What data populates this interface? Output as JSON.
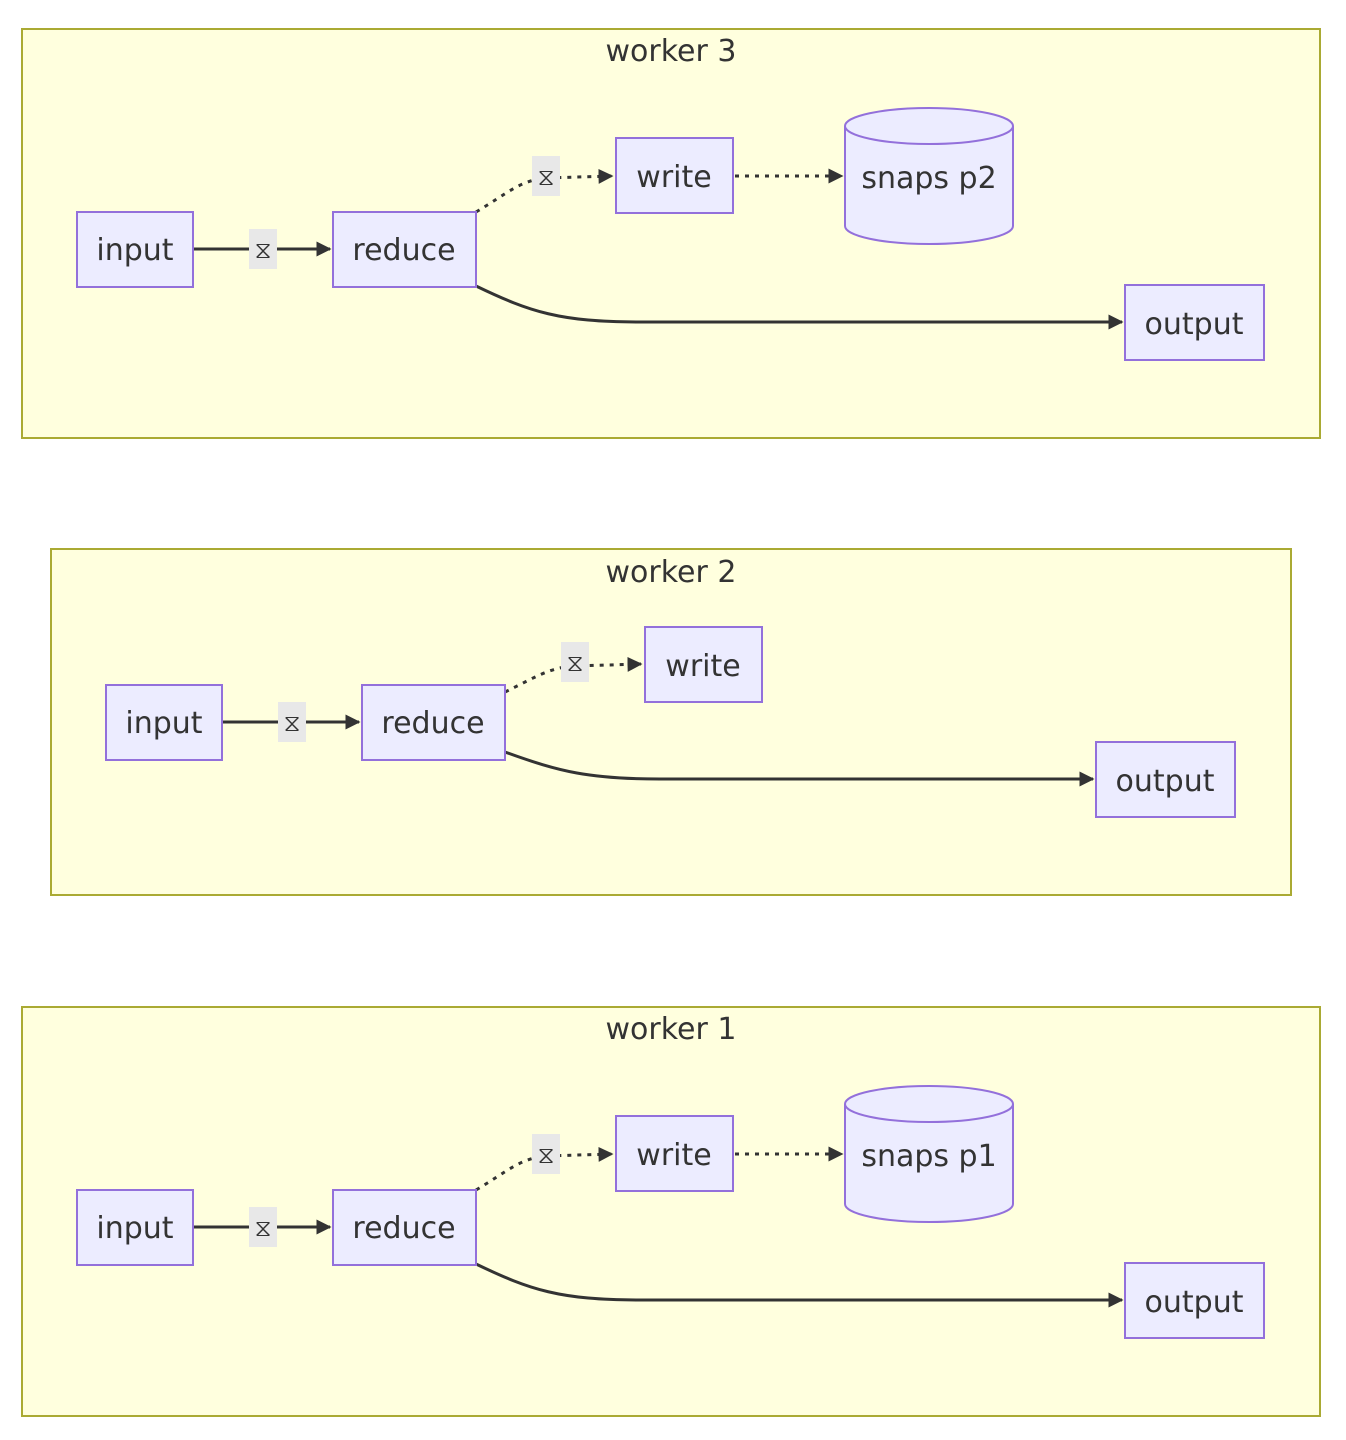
{
  "diagram": {
    "type": "flowchart",
    "edge_label_icon": "hourglass-icon",
    "edge_label_glyph": "⧖",
    "colors": {
      "cluster_fill": "#ffffde",
      "cluster_stroke": "#aaaa33",
      "node_fill": "#ececff",
      "node_stroke": "#9370db",
      "edge": "#333333",
      "text": "#333333"
    },
    "clusters": [
      {
        "title": "worker 3",
        "nodes": {
          "input": "input",
          "reduce": "reduce",
          "write": "write",
          "store": "snaps p2",
          "output": "output"
        },
        "edges": [
          {
            "from": "input",
            "to": "reduce",
            "style": "solid",
            "label": "⧖"
          },
          {
            "from": "reduce",
            "to": "write",
            "style": "dotted",
            "label": "⧖"
          },
          {
            "from": "write",
            "to": "snaps p2",
            "style": "dotted",
            "label": ""
          },
          {
            "from": "reduce",
            "to": "output",
            "style": "solid",
            "label": ""
          }
        ]
      },
      {
        "title": "worker 2",
        "nodes": {
          "input": "input",
          "reduce": "reduce",
          "write": "write",
          "output": "output"
        },
        "edges": [
          {
            "from": "input",
            "to": "reduce",
            "style": "solid",
            "label": "⧖"
          },
          {
            "from": "reduce",
            "to": "write",
            "style": "dotted",
            "label": "⧖"
          },
          {
            "from": "reduce",
            "to": "output",
            "style": "solid",
            "label": ""
          }
        ]
      },
      {
        "title": "worker 1",
        "nodes": {
          "input": "input",
          "reduce": "reduce",
          "write": "write",
          "store": "snaps p1",
          "output": "output"
        },
        "edges": [
          {
            "from": "input",
            "to": "reduce",
            "style": "solid",
            "label": "⧖"
          },
          {
            "from": "reduce",
            "to": "write",
            "style": "dotted",
            "label": "⧖"
          },
          {
            "from": "write",
            "to": "snaps p1",
            "style": "dotted",
            "label": ""
          },
          {
            "from": "reduce",
            "to": "output",
            "style": "solid",
            "label": ""
          }
        ]
      }
    ]
  }
}
